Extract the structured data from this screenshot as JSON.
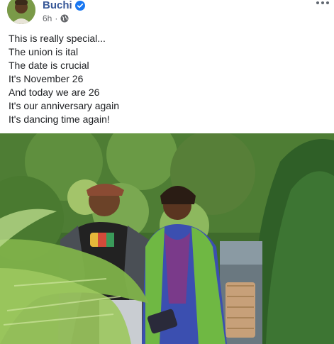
{
  "post": {
    "author": "Buchi",
    "time": "6h",
    "lines": [
      "This is really special...",
      "The union is ital",
      "The date is crucial",
      "It's November 26",
      "And today we are 26",
      "It's our anniversary again",
      "It's dancing time again!"
    ],
    "separator": "·",
    "icons": {
      "verified": "verified-badge-icon",
      "audience": "globe-icon",
      "more": "more-options-icon"
    }
  },
  "colors": {
    "author_link": "#385898",
    "verified_blue": "#1877f2",
    "meta_gray": "#65676b"
  }
}
